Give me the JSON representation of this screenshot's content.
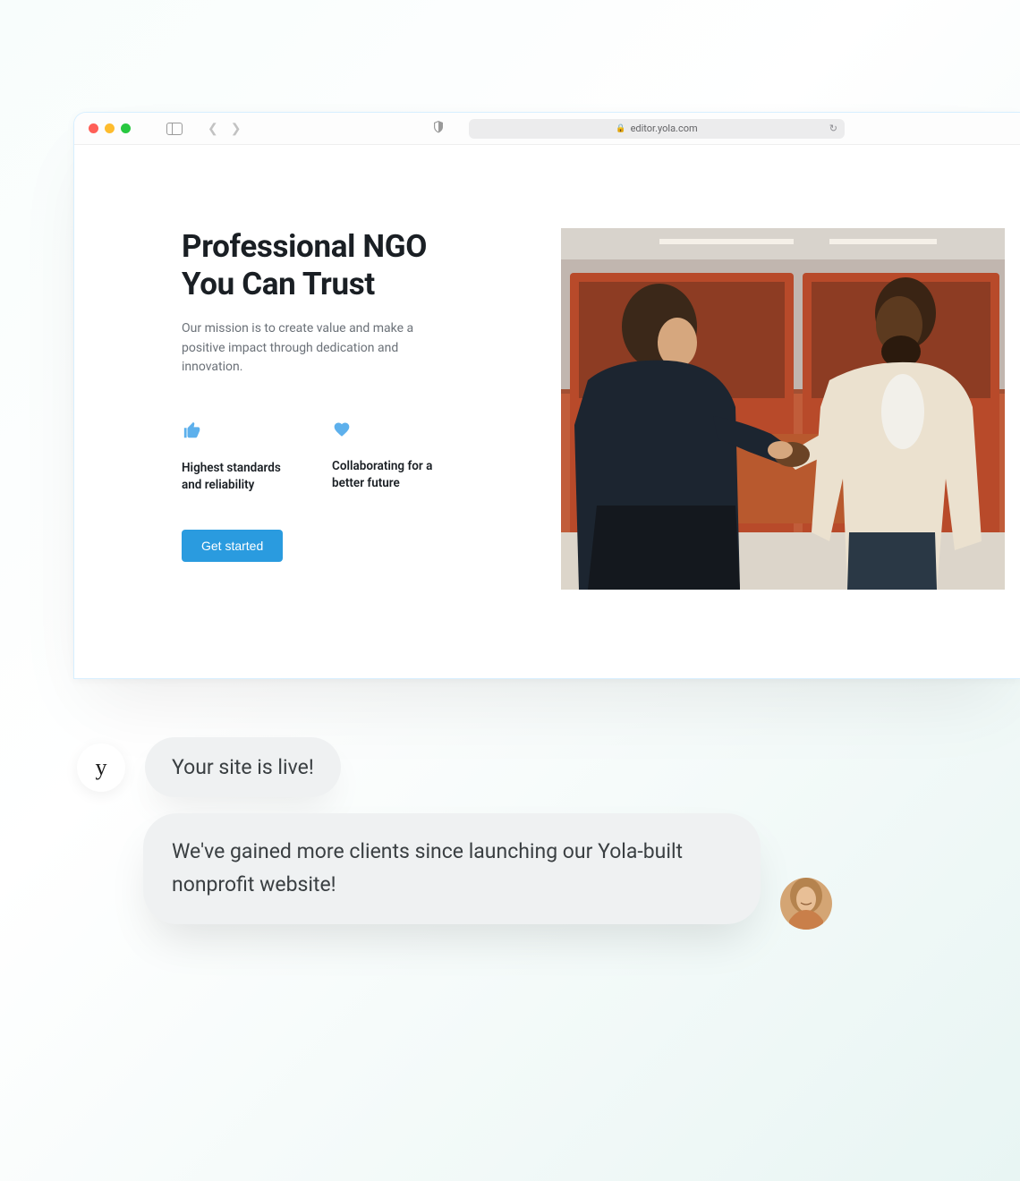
{
  "browser": {
    "url": "editor.yola.com"
  },
  "hero": {
    "title": "Professional NGO You Can Trust",
    "subtitle": "Our mission is to create value and make a positive impact through dedication and innovation.",
    "cta": "Get started"
  },
  "features": [
    {
      "icon": "thumbs-up-icon",
      "text": "Highest standards and reliability"
    },
    {
      "icon": "heart-icon",
      "text": "Collaborating for a better future"
    }
  ],
  "chat": {
    "logo_letter": "y",
    "bubble1": "Your site is live!",
    "bubble2": "We've gained more clients since launching our Yola-built nonprofit website!"
  }
}
